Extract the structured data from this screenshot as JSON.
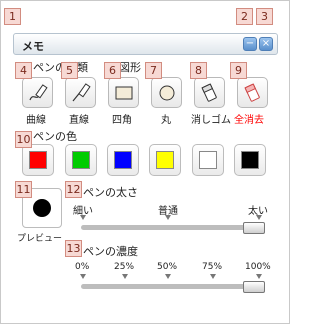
{
  "window": {
    "title": "メモ",
    "minimize_glyph": "−",
    "close_glyph": "×"
  },
  "callouts": [
    "1",
    "2",
    "3",
    "4",
    "5",
    "6",
    "7",
    "8",
    "9",
    "10",
    "11",
    "12",
    "13"
  ],
  "sections": {
    "pen_type": "ペンの種類",
    "shapes": "図形",
    "pen_color": "ペンの色",
    "pen_width": "ペンの太さ",
    "pen_opacity": "ペンの濃度"
  },
  "tools": [
    {
      "label": "曲線",
      "icon": "pencil-curve-icon"
    },
    {
      "label": "直線",
      "icon": "pencil-line-icon"
    },
    {
      "label": "四角",
      "icon": "rectangle-icon"
    },
    {
      "label": "丸",
      "icon": "circle-icon"
    },
    {
      "label": "消しゴム",
      "icon": "eraser-icon"
    },
    {
      "label": "全消去",
      "icon": "eraser-red-icon",
      "color": "#ff0000"
    }
  ],
  "colors": [
    "#ff0000",
    "#00cc00",
    "#0000ff",
    "#ffff00",
    "#ffffff",
    "#000000"
  ],
  "preview_label": "プレビュー",
  "width_slider": {
    "ticks": [
      "細い",
      "普通",
      "太い"
    ],
    "value": "太い"
  },
  "opacity_slider": {
    "ticks": [
      "0%",
      "25%",
      "50%",
      "75%",
      "100%"
    ],
    "value": "100%"
  }
}
